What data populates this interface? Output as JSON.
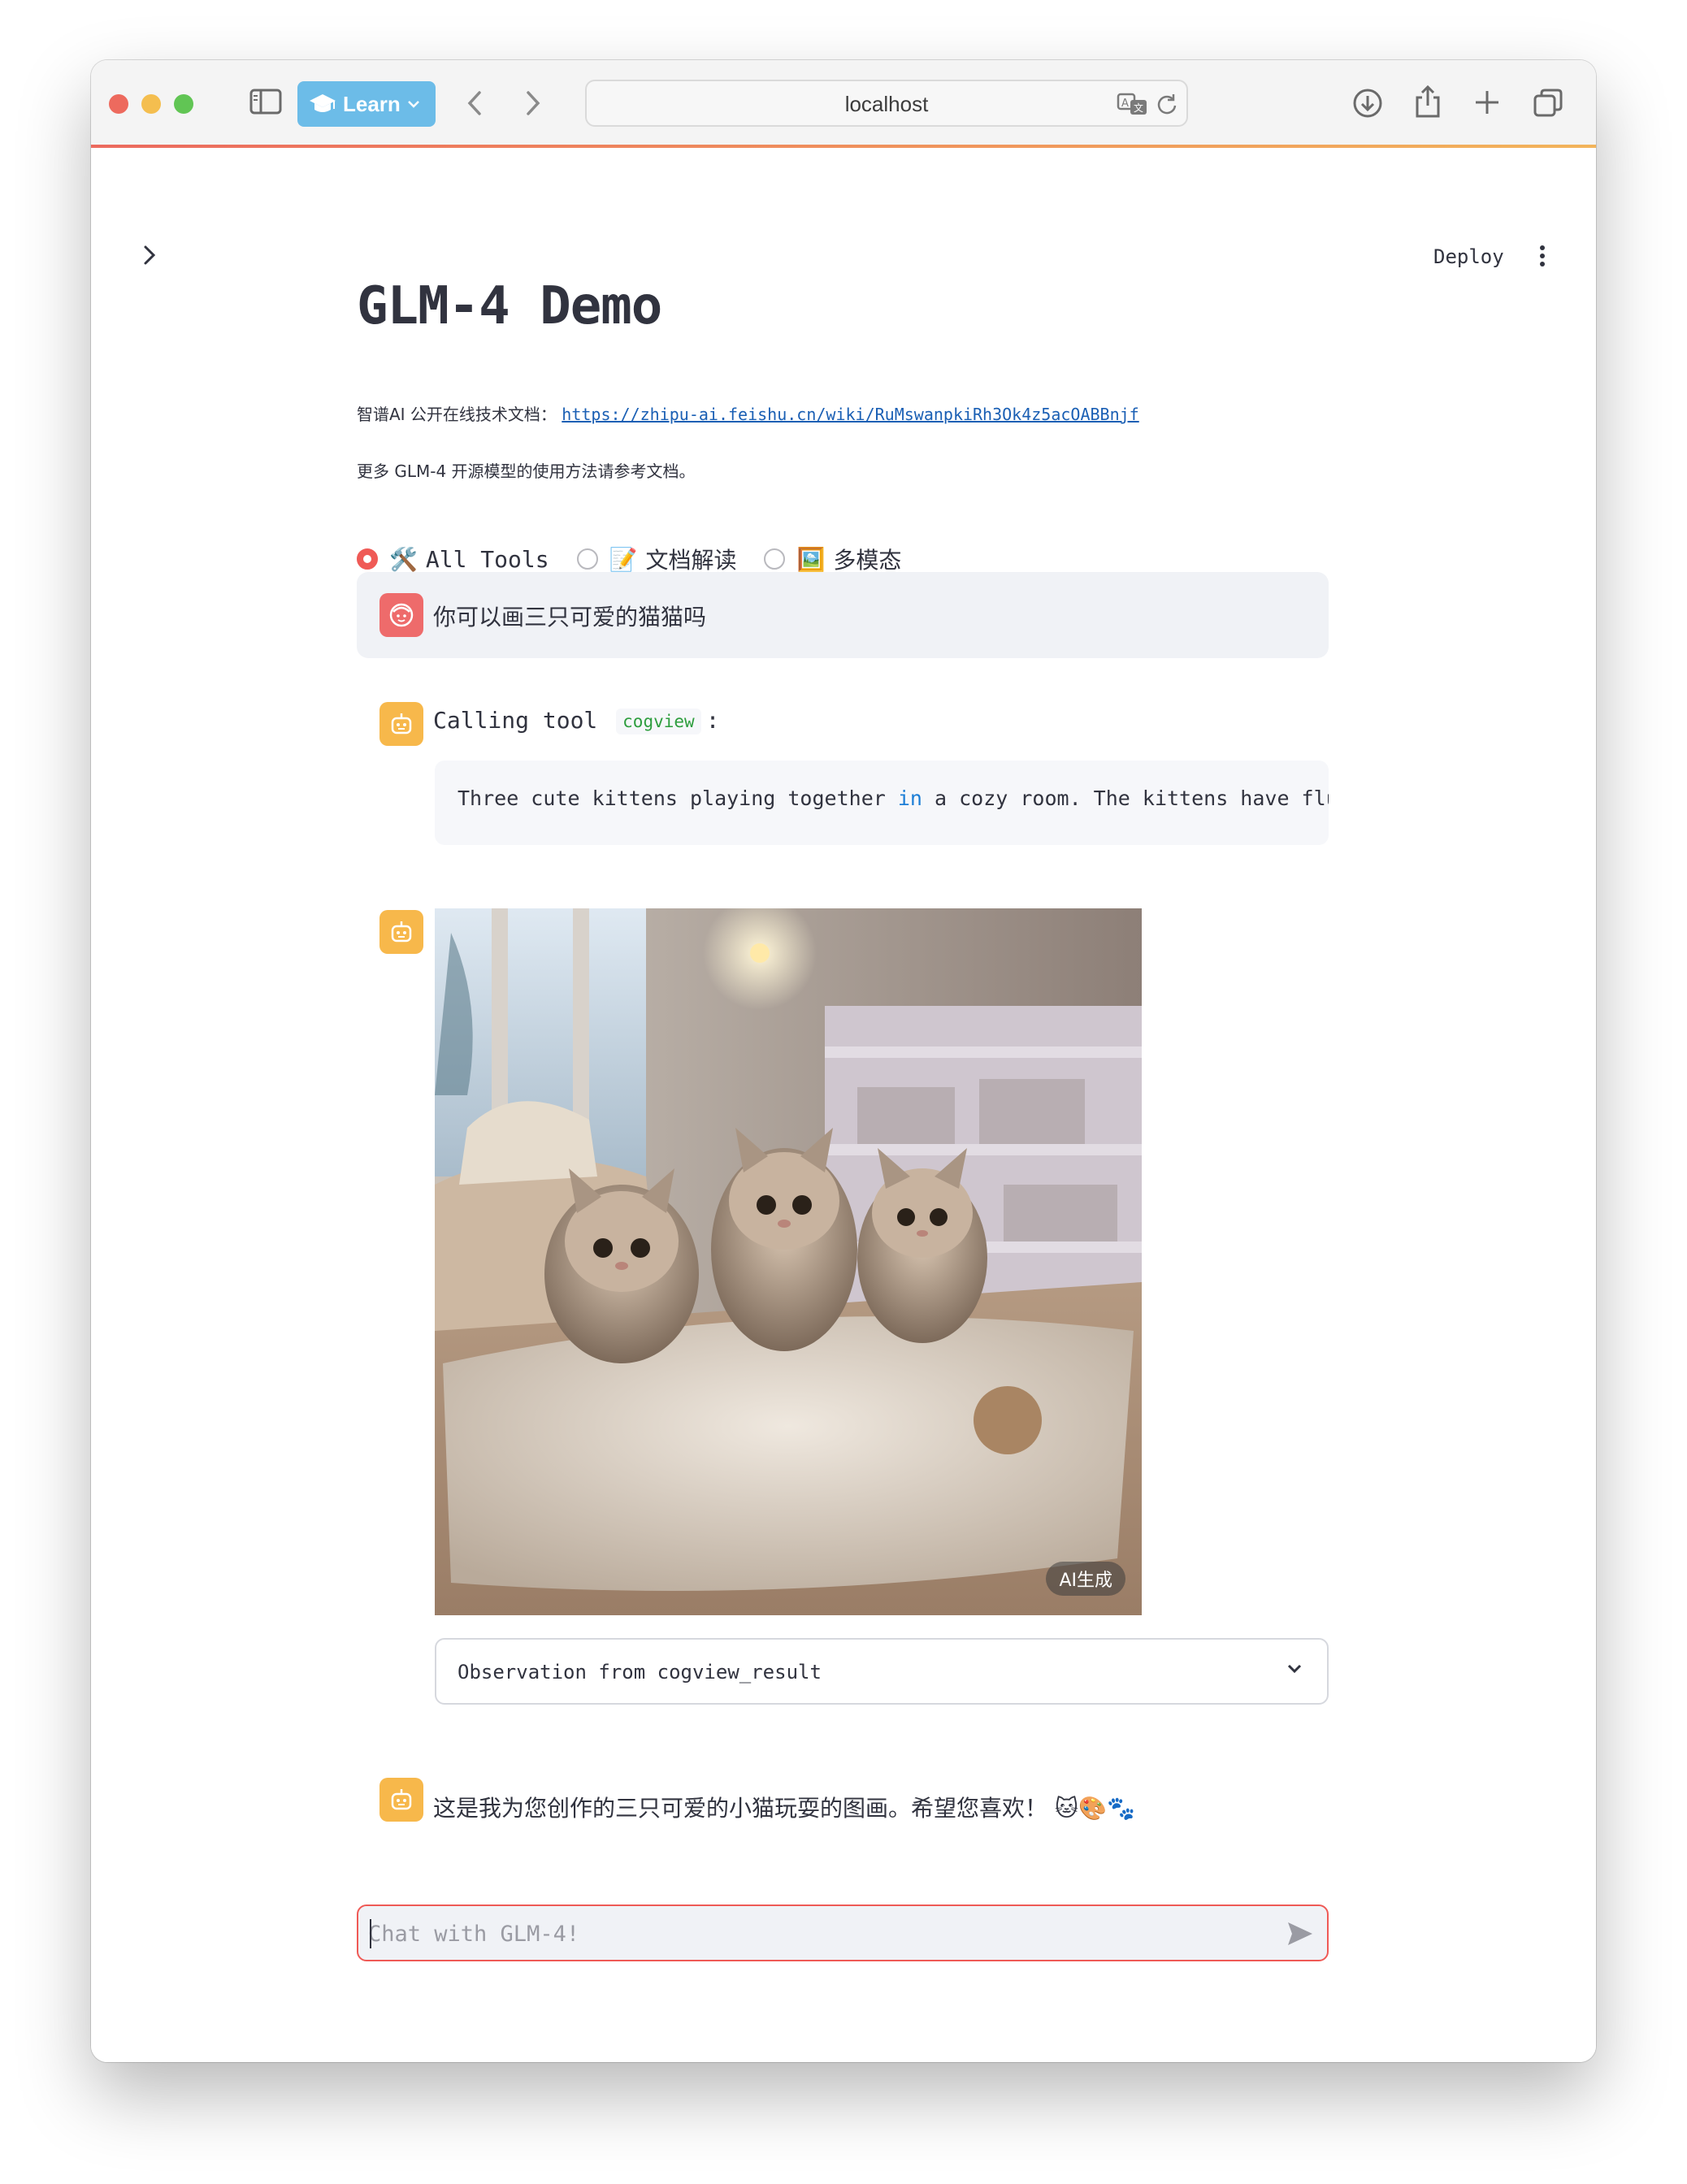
{
  "browser": {
    "learn_label": "Learn",
    "address": "localhost"
  },
  "app": {
    "deploy_label": "Deploy",
    "title": "GLM-4 Demo",
    "doc_prefix": "智谱AI 公开在线技术文档：",
    "doc_link": "https://zhipu-ai.feishu.cn/wiki/RuMswanpkiRh3Ok4z5acOABBnjf",
    "doc_note": "更多 GLM-4 开源模型的使用方法请参考文档。"
  },
  "modes": [
    {
      "icon": "🛠️",
      "label": "All Tools",
      "selected": true
    },
    {
      "icon": "📝",
      "label": "文档解读",
      "selected": false
    },
    {
      "icon": "🖼️",
      "label": "多模态",
      "selected": false
    }
  ],
  "chat": {
    "user_message": "你可以画三只可爱的猫猫吗",
    "tool_call_prefix": "Calling tool",
    "tool_name": "cogview",
    "tool_call_suffix": ":",
    "code_before_kw": "Three cute kittens playing together ",
    "code_kw": "in",
    "code_after_kw": " a cozy room. The kittens have fluffy",
    "image_badge": "AI生成",
    "observation_label": "Observation from cogview_result",
    "final_message": "这是我为您创作的三只可爱的小猫玩耍的图画。希望您喜欢！",
    "final_emojis": "🐱🎨🐾",
    "input_placeholder": "Chat with GLM-4!"
  },
  "colors": {
    "primary": "#ef5a56",
    "user_avatar": "#ee6b6b",
    "assistant_avatar": "#f7b84b",
    "link": "#1a5fb4"
  }
}
